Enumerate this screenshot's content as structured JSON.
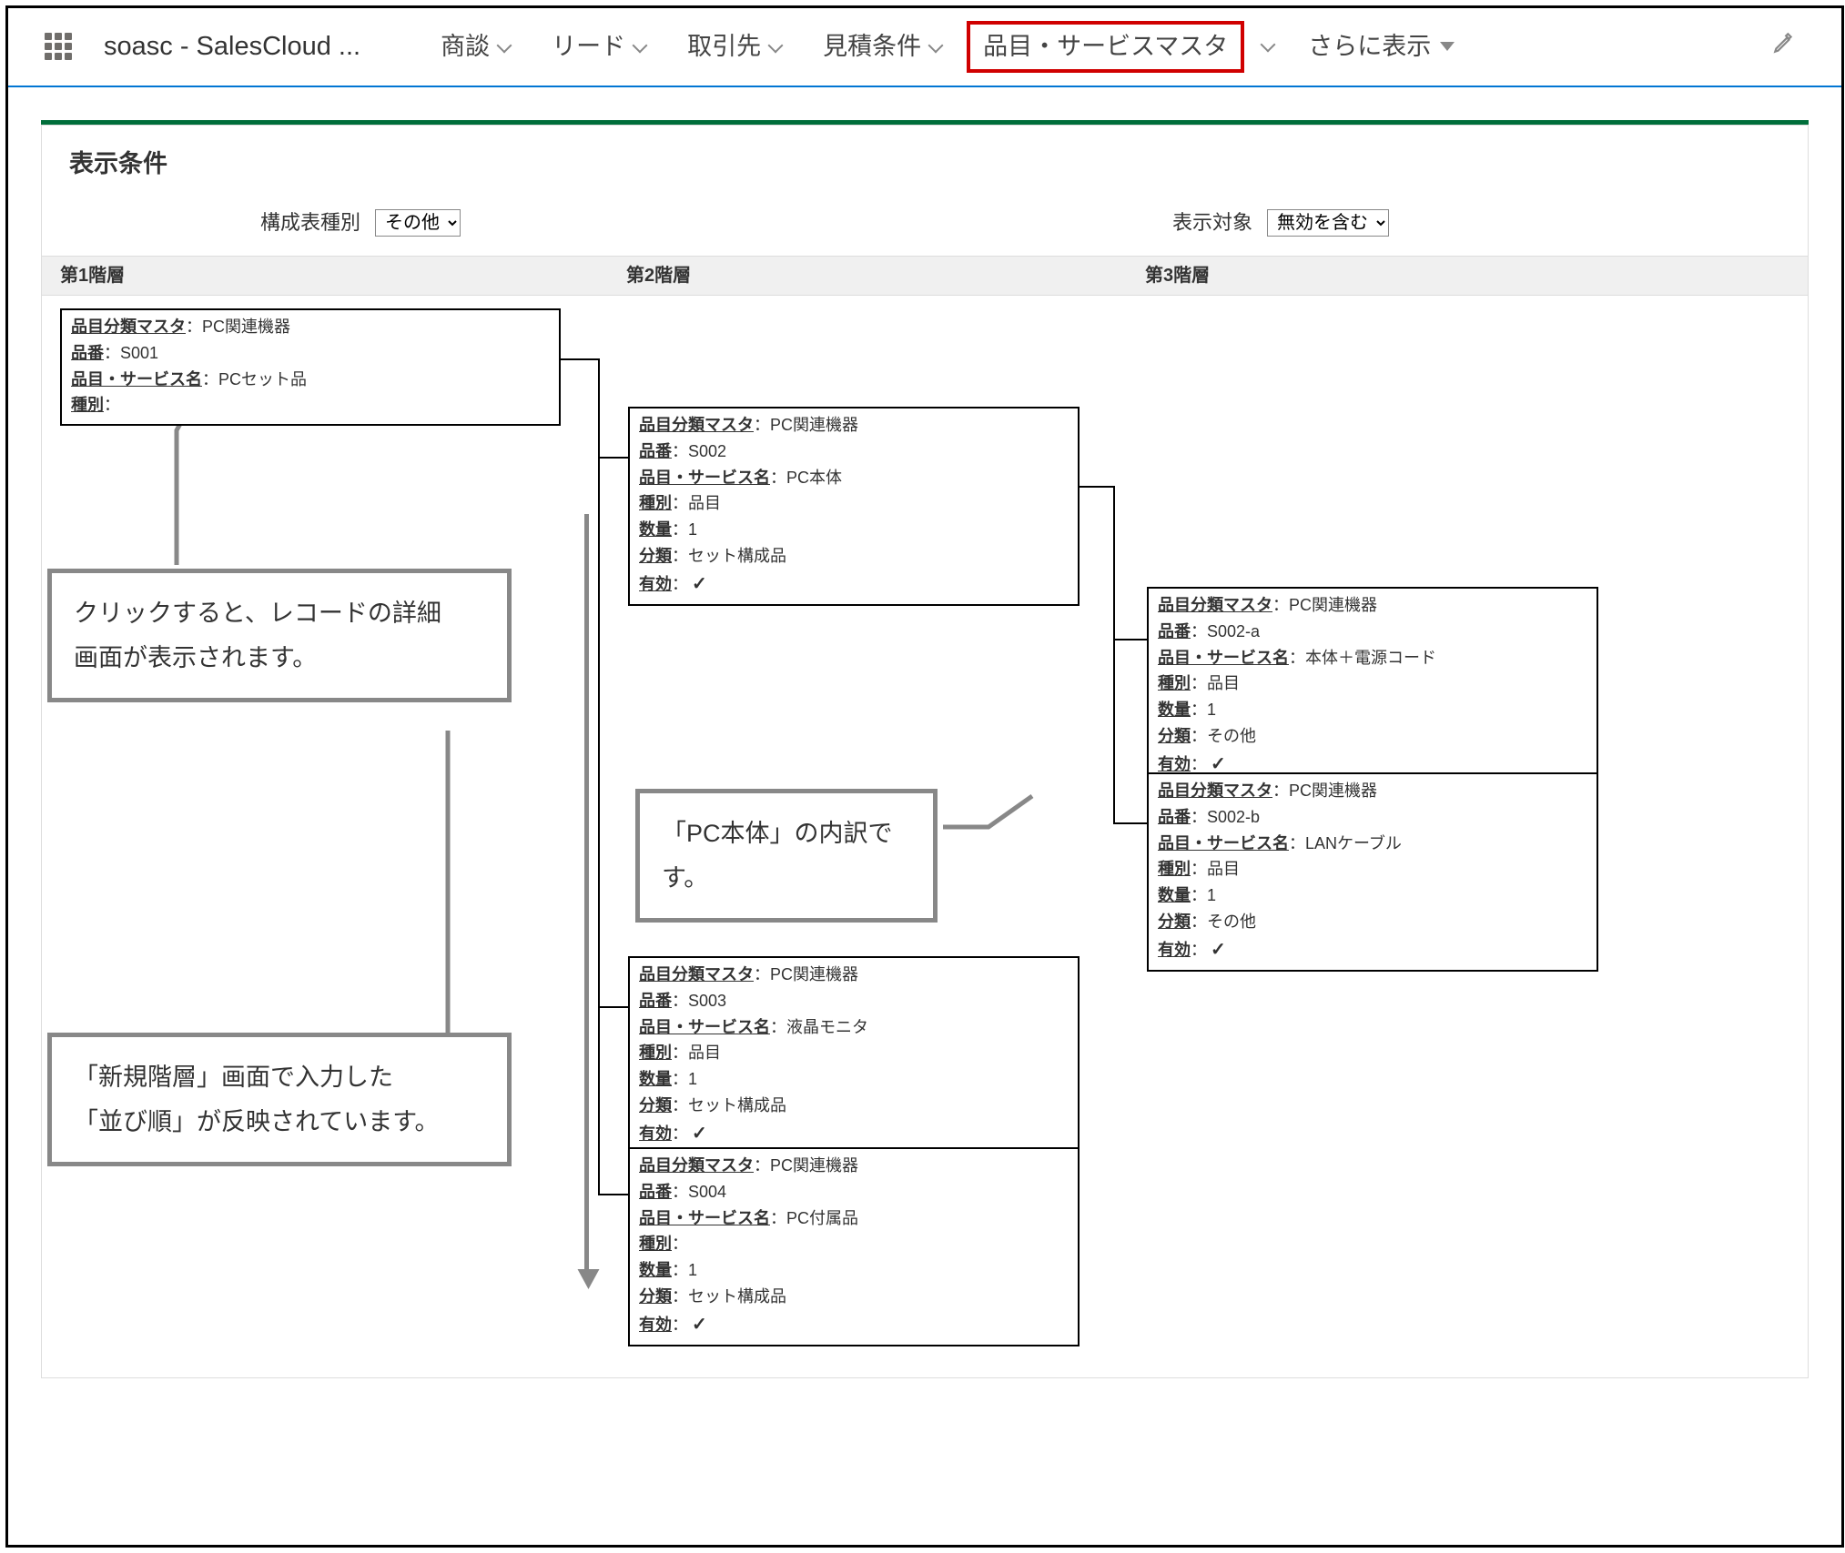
{
  "nav": {
    "app_name": "soasc - SalesCloud ...",
    "items": [
      {
        "label": "商談"
      },
      {
        "label": "リード"
      },
      {
        "label": "取引先"
      },
      {
        "label": "見積条件"
      },
      {
        "label": "品目・サービスマスタ",
        "highlight": true
      },
      {
        "label": "さらに表示"
      }
    ]
  },
  "section_title": "表示条件",
  "filters": {
    "type_label": "構成表種別",
    "type_value": "その他",
    "target_label": "表示対象",
    "target_value": "無効を含む"
  },
  "levels": {
    "l1": "第1階層",
    "l2": "第2階層",
    "l3": "第3階層"
  },
  "field_labels": {
    "master": "品目分類マスタ",
    "code": "品番",
    "name": "品目・サービス名",
    "type": "種別",
    "qty": "数量",
    "cat": "分類",
    "enabled": "有効"
  },
  "cards": {
    "c1": {
      "master": "PC関連機器",
      "code": "S001",
      "name": "PCセット品",
      "type": ""
    },
    "c2": {
      "master": "PC関連機器",
      "code": "S002",
      "name": "PC本体",
      "type": "品目",
      "qty": "1",
      "cat": "セット構成品",
      "enabled": true
    },
    "c3": {
      "master": "PC関連機器",
      "code": "S003",
      "name": "液晶モニタ",
      "type": "品目",
      "qty": "1",
      "cat": "セット構成品",
      "enabled": true
    },
    "c4": {
      "master": "PC関連機器",
      "code": "S004",
      "name": "PC付属品",
      "type": "",
      "qty": "1",
      "cat": "セット構成品",
      "enabled": true
    },
    "c5": {
      "master": "PC関連機器",
      "code": "S002-a",
      "name": "本体＋電源コード",
      "type": "品目",
      "qty": "1",
      "cat": "その他",
      "enabled": true
    },
    "c6": {
      "master": "PC関連機器",
      "code": "S002-b",
      "name": "LANケーブル",
      "type": "品目",
      "qty": "1",
      "cat": "その他",
      "enabled": true
    }
  },
  "callouts": {
    "a": "クリックすると、レコードの詳細\n画面が表示されます。",
    "b": "「PC本体」の内訳です。",
    "c": "「新規階層」画面で入力した\n「並び順」が反映されています。"
  },
  "sep": "："
}
